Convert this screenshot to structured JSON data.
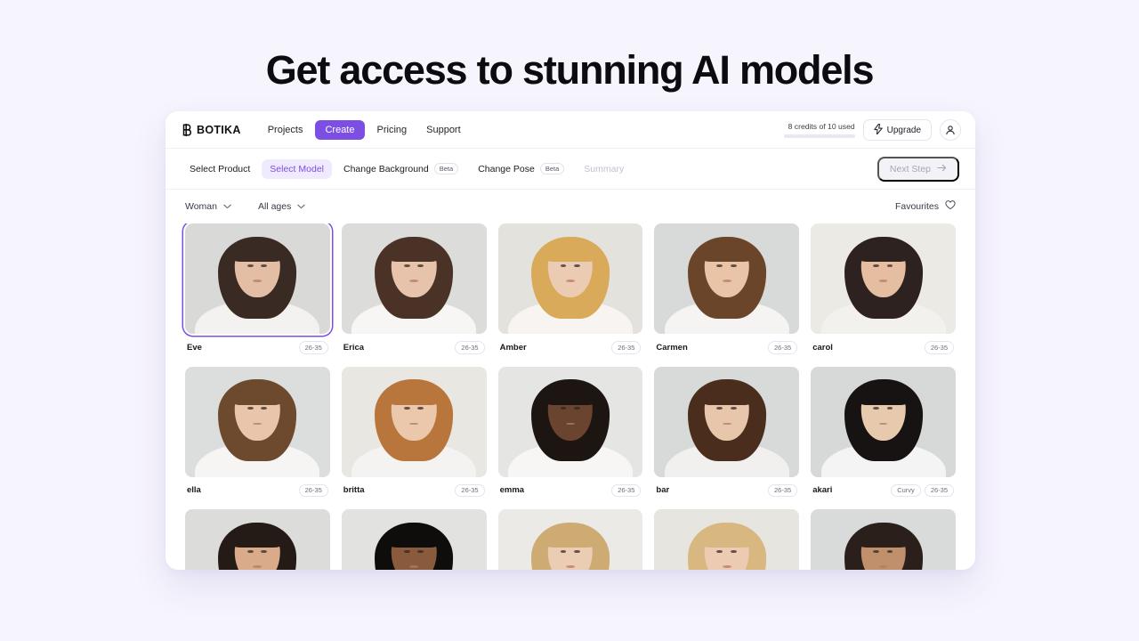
{
  "page": {
    "title": "Get access to stunning AI models",
    "background_color": "#f6f4fd",
    "accent_color": "#7c4ee4"
  },
  "topbar": {
    "brand": "BOTIKA",
    "brand_icon": "botika-b-logo-icon",
    "nav": [
      {
        "label": "Projects",
        "active": false
      },
      {
        "label": "Create",
        "active": true
      },
      {
        "label": "Pricing",
        "active": false
      },
      {
        "label": "Support",
        "active": false
      }
    ],
    "credits": {
      "label": "8 credits of 10 used",
      "used": 8,
      "total": 10,
      "percent": 80
    },
    "upgrade_label": "Upgrade",
    "upgrade_icon": "lightning-bolt-icon",
    "account_icon": "user-avatar-icon"
  },
  "steps": {
    "items": [
      {
        "label": "Select Product",
        "state": "default",
        "badge": ""
      },
      {
        "label": "Select Model",
        "state": "current",
        "badge": ""
      },
      {
        "label": "Change Background",
        "state": "default",
        "badge": "Beta"
      },
      {
        "label": "Change Pose",
        "state": "default",
        "badge": "Beta"
      },
      {
        "label": "Summary",
        "state": "disabled",
        "badge": ""
      }
    ],
    "next_label": "Next Step",
    "next_icon": "arrow-right-icon"
  },
  "filters": {
    "gender": {
      "label": "Woman",
      "icon": "chevron-down-icon"
    },
    "age": {
      "label": "All ages",
      "icon": "chevron-down-icon"
    },
    "favourites": {
      "label": "Favourites",
      "icon": "heart-outline-icon"
    }
  },
  "models": [
    {
      "name": "Eve",
      "badges": [
        "26-35"
      ],
      "selected": true,
      "bg": "#d9d9d7",
      "hair": "#3a2a24",
      "skin": "#e3bda4",
      "top": "#f4f2f0"
    },
    {
      "name": "Erica",
      "badges": [
        "26-35"
      ],
      "selected": false,
      "bg": "#dcdcdb",
      "hair": "#4a3226",
      "skin": "#e6c3aa",
      "top": "#f7f6f5"
    },
    {
      "name": "Amber",
      "badges": [
        "26-35"
      ],
      "selected": false,
      "bg": "#e3e2dc",
      "hair": "#d8aa5a",
      "skin": "#eccbb3",
      "top": "#f7f4f1"
    },
    {
      "name": "Carmen",
      "badges": [
        "26-35"
      ],
      "selected": false,
      "bg": "#d7dad9",
      "hair": "#6b4529",
      "skin": "#e9c4a6",
      "top": "#f5f4f3"
    },
    {
      "name": "carol",
      "badges": [
        "26-35"
      ],
      "selected": false,
      "bg": "#eceae5",
      "hair": "#2e2220",
      "skin": "#e5bda0",
      "top": "#f3f1ee"
    },
    {
      "name": "ella",
      "badges": [
        "26-35"
      ],
      "selected": false,
      "bg": "#dcdedd",
      "hair": "#6d4a2e",
      "skin": "#e8c5ab",
      "top": "#f6f5f4"
    },
    {
      "name": "britta",
      "badges": [
        "26-35"
      ],
      "selected": false,
      "bg": "#e9e7e2",
      "hair": "#b8763c",
      "skin": "#ebc7ab",
      "top": "#f5f3f1"
    },
    {
      "name": "emma",
      "badges": [
        "26-35"
      ],
      "selected": false,
      "bg": "#e5e5e3",
      "hair": "#1d1512",
      "skin": "#6b4430",
      "top": "#f7f6f5"
    },
    {
      "name": "bar",
      "badges": [
        "26-35"
      ],
      "selected": false,
      "bg": "#d8dad9",
      "hair": "#4a2d1d",
      "skin": "#e8c6ab",
      "top": "#f2f0ef"
    },
    {
      "name": "akari",
      "badges": [
        "Curvy",
        "26-35"
      ],
      "selected": false,
      "bg": "#d6d9d8",
      "hair": "#171312",
      "skin": "#e7c9ad",
      "top": "#f5f4f4"
    },
    {
      "name": "",
      "badges": [],
      "selected": false,
      "bg": "#dcdcda",
      "hair": "#241a16",
      "skin": "#d9ab8a",
      "top": "#f4f2f1"
    },
    {
      "name": "",
      "badges": [],
      "selected": false,
      "bg": "#e2e2e0",
      "hair": "#0f0c0c",
      "skin": "#8a5a3c",
      "top": "#f6f5f4"
    },
    {
      "name": "",
      "badges": [],
      "selected": false,
      "bg": "#eceae7",
      "hair": "#cdab73",
      "skin": "#ebcdb4",
      "top": "#f7f5f3"
    },
    {
      "name": "",
      "badges": [],
      "selected": false,
      "bg": "#e6e5e0",
      "hair": "#d9b781",
      "skin": "#eccbb2",
      "top": "#f6f4f2"
    },
    {
      "name": "",
      "badges": [],
      "selected": false,
      "bg": "#d9dbda",
      "hair": "#2a1f1b",
      "skin": "#c08f6c",
      "top": "#f3f2f1"
    }
  ]
}
